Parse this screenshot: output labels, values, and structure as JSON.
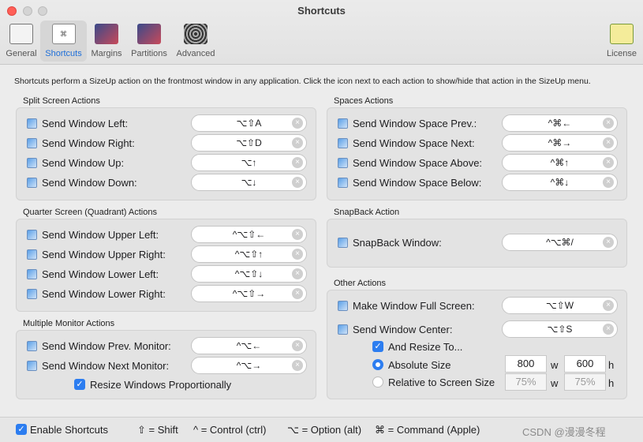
{
  "window": {
    "title": "Shortcuts"
  },
  "toolbar": {
    "items": [
      {
        "label": "General"
      },
      {
        "label": "Shortcuts"
      },
      {
        "label": "Margins"
      },
      {
        "label": "Partitions"
      },
      {
        "label": "Advanced"
      }
    ],
    "license": "License"
  },
  "description": "Shortcuts perform a SizeUp action on the frontmost window in any application. Click the icon next to each action to show/hide that action in the SizeUp menu.",
  "split": {
    "title": "Split Screen Actions",
    "rows": [
      {
        "label": "Send Window Left:",
        "key": "⌥⇧A"
      },
      {
        "label": "Send Window Right:",
        "key": "⌥⇧D"
      },
      {
        "label": "Send Window Up:",
        "key": "⌥↑"
      },
      {
        "label": "Send Window Down:",
        "key": "⌥↓"
      }
    ]
  },
  "quarter": {
    "title": "Quarter Screen (Quadrant) Actions",
    "rows": [
      {
        "label": "Send Window Upper Left:",
        "key": "^⌥⇧←"
      },
      {
        "label": "Send Window Upper Right:",
        "key": "^⌥⇧↑"
      },
      {
        "label": "Send Window Lower Left:",
        "key": "^⌥⇧↓"
      },
      {
        "label": "Send Window Lower Right:",
        "key": "^⌥⇧→"
      }
    ]
  },
  "monitor": {
    "title": "Multiple Monitor Actions",
    "rows": [
      {
        "label": "Send Window Prev. Monitor:",
        "key": "^⌥←"
      },
      {
        "label": "Send Window Next Monitor:",
        "key": "^⌥→"
      }
    ],
    "resize_label": "Resize Windows Proportionally"
  },
  "spaces": {
    "title": "Spaces Actions",
    "rows": [
      {
        "label": "Send Window Space Prev.:",
        "key": "^⌘←"
      },
      {
        "label": "Send Window Space Next:",
        "key": "^⌘→"
      },
      {
        "label": "Send Window Space Above:",
        "key": "^⌘↑"
      },
      {
        "label": "Send Window Space Below:",
        "key": "^⌘↓"
      }
    ]
  },
  "snapback": {
    "title": "SnapBack Action",
    "rows": [
      {
        "label": "SnapBack Window:",
        "key": "^⌥⌘/"
      }
    ]
  },
  "other": {
    "title": "Other Actions",
    "rows": [
      {
        "label": "Make Window Full Screen:",
        "key": "⌥⇧W"
      },
      {
        "label": "Send Window Center:",
        "key": "⌥⇧S"
      }
    ],
    "and_resize": "And Resize To...",
    "absolute": {
      "label": "Absolute Size",
      "w": "800",
      "h": "600"
    },
    "relative": {
      "label": "Relative to Screen Size",
      "w": "75%",
      "h": "75%"
    },
    "w": "w",
    "h": "h"
  },
  "footer": {
    "enable": "Enable Shortcuts",
    "shift": "⇧ = Shift",
    "control": "^ = Control (ctrl)",
    "option": "⌥ = Option (alt)",
    "command": "⌘ = Command (Apple)",
    "watermark": "CSDN @漫漫冬程"
  },
  "colors": {
    "accent": "#2c7df0",
    "close": "#ff5f57"
  }
}
